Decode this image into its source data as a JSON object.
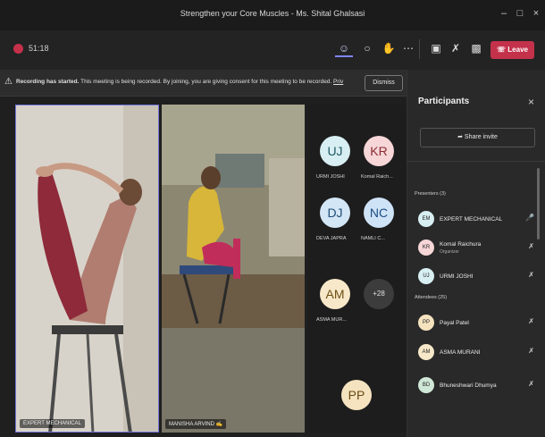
{
  "window": {
    "title": "Strengthen your Core Muscles - Ms. Shital Ghalsasi"
  },
  "toolbar": {
    "timer": "51:18",
    "leave_label": "Leave",
    "icons": [
      "people-icon",
      "chat-icon",
      "raise-hand-icon",
      "more-icon",
      "camera-off-icon",
      "mic-off-icon",
      "share-screen-icon"
    ]
  },
  "banner": {
    "title": "Recording has started.",
    "message": " This meeting is being recorded. By joining, you are giving consent for this meeting to be recorded.",
    "privacy_link": "Priv",
    "dismiss_label": "Dismiss"
  },
  "videos": [
    {
      "name": "EXPERT MECHANICAL"
    },
    {
      "name": "MANISHA ARVIND ✍"
    }
  ],
  "gallery": [
    {
      "initials": "UJ",
      "label": "URMI JOSHI"
    },
    {
      "initials": "KR",
      "label": "Komal Raich..."
    },
    {
      "initials": "DJ",
      "label": "DEVA JAPRA"
    },
    {
      "initials": "NC",
      "label": "NAMLI C..."
    },
    {
      "initials": "AM",
      "label": "ASMA MUR..."
    },
    {
      "initials": "+28",
      "label": ""
    },
    {
      "initials": "PP",
      "label": ""
    }
  ],
  "panel": {
    "title": "Participants",
    "share_invite": "Share invite",
    "presenters_label": "Presenters (3)",
    "attendees_label": "Attendees (25)",
    "presenters": [
      {
        "initials": "EM",
        "name": "EXPERT MECHANICAL",
        "sub": ""
      },
      {
        "initials": "KR",
        "name": "Komal Raichura",
        "sub": "Organizer"
      },
      {
        "initials": "UJ",
        "name": "URMI JOSHI",
        "sub": ""
      }
    ],
    "attendees": [
      {
        "initials": "PP",
        "name": "Payal Patel",
        "sub": ""
      },
      {
        "initials": "AM",
        "name": "ASMA MURANI",
        "sub": ""
      },
      {
        "initials": "BD",
        "name": "Bhuneshwari Dhumya",
        "sub": ""
      }
    ]
  },
  "colors": {
    "accent": "#7f85f5",
    "leave": "#c4314b",
    "background": "#1f1f1f"
  }
}
